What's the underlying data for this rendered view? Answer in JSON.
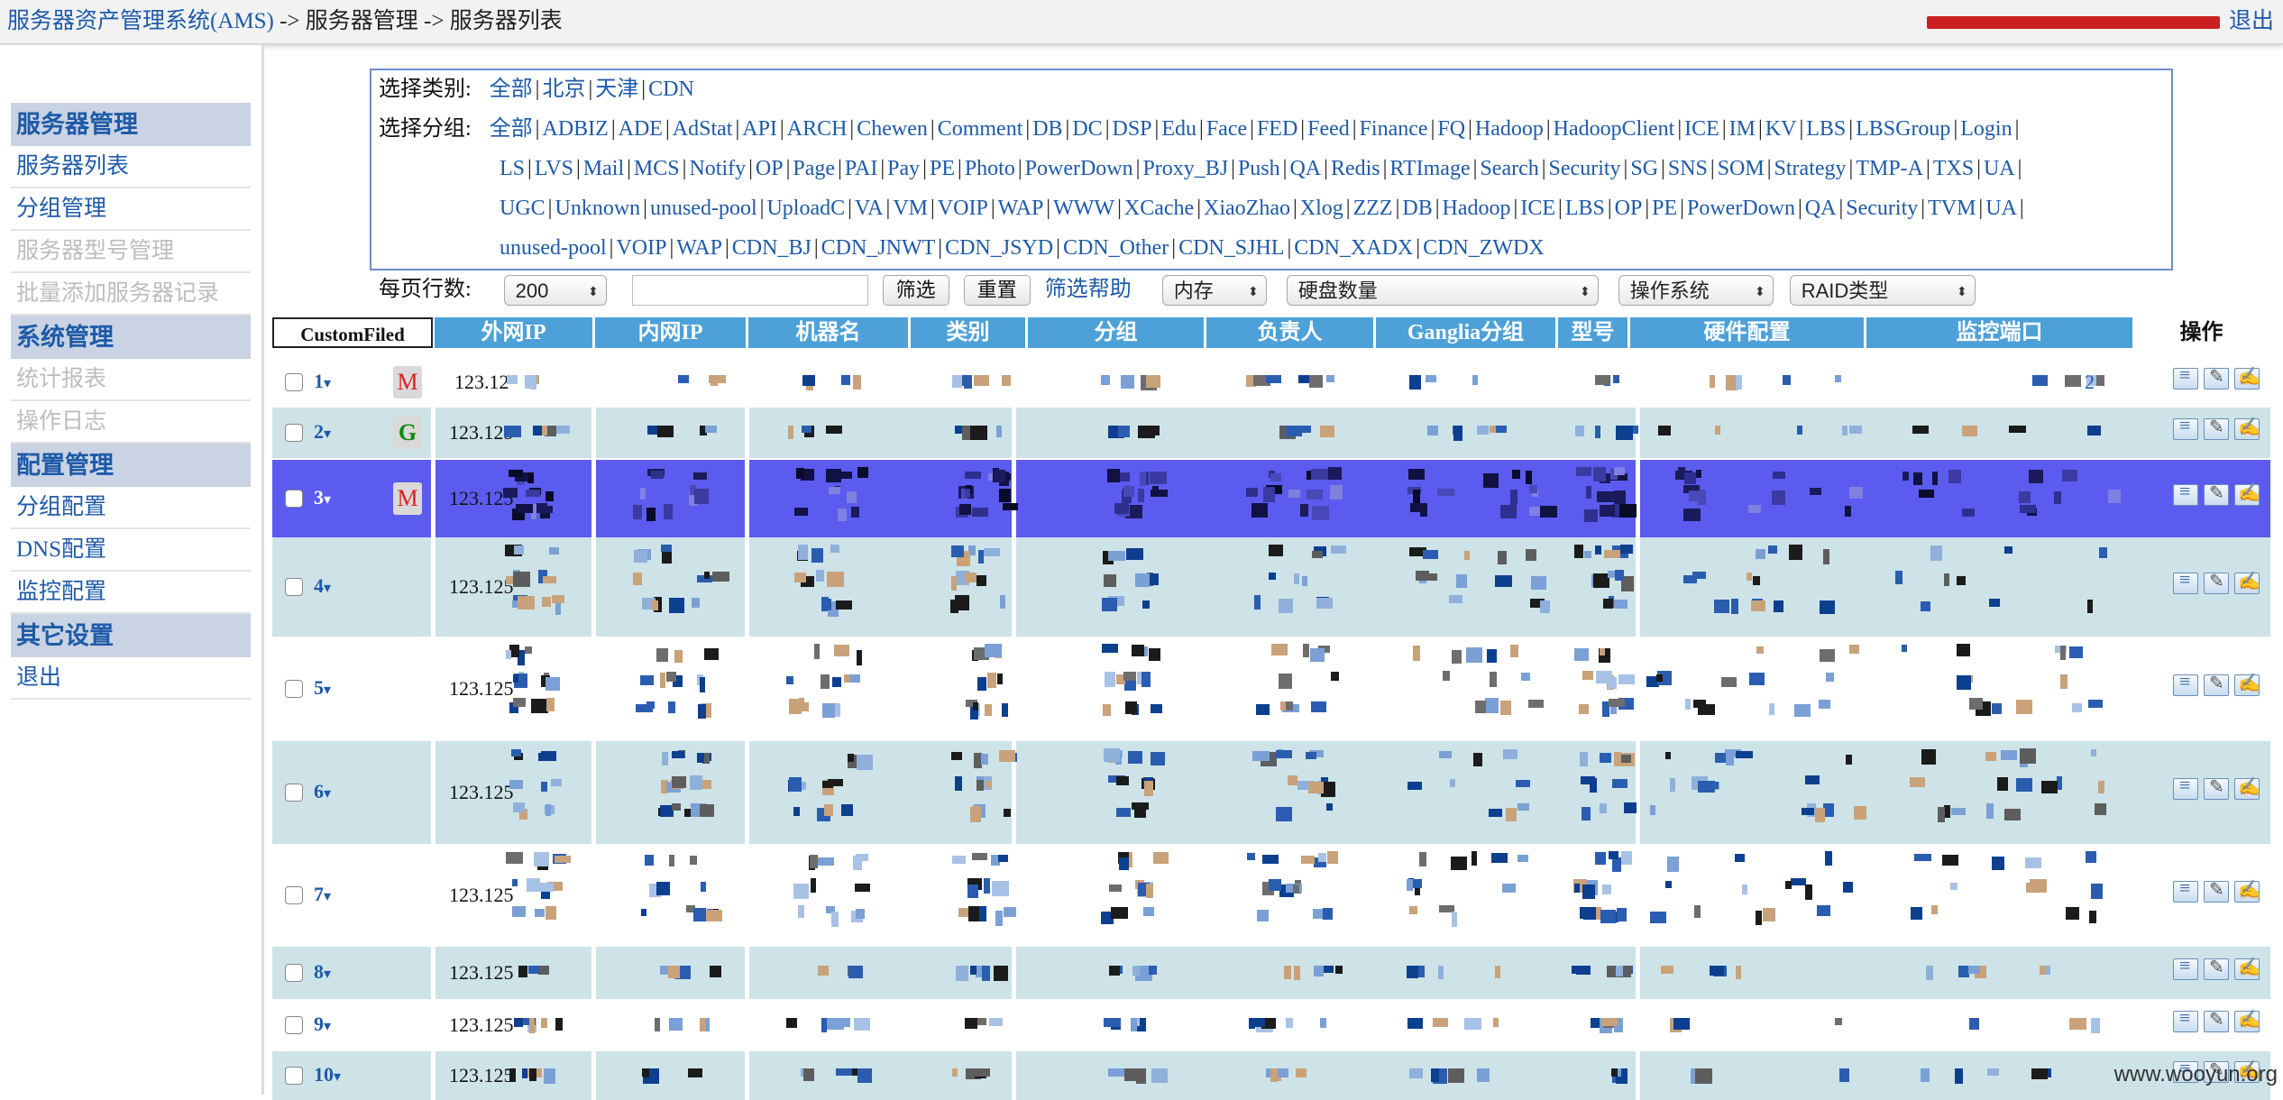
{
  "header": {
    "app_title": "服务器资产管理系统(AMS)",
    "crumb_sep": "->",
    "crumb_2": "服务器管理",
    "crumb_3": "服务器列表",
    "logout": "退出"
  },
  "sidebar": {
    "sections": [
      {
        "title": "服务器管理",
        "items": [
          {
            "label": "服务器列表",
            "state": "active"
          },
          {
            "label": "分组管理",
            "state": "active"
          },
          {
            "label": "服务器型号管理",
            "state": "disabled"
          },
          {
            "label": "批量添加服务器记录",
            "state": "disabled"
          }
        ]
      },
      {
        "title": "系统管理",
        "items": [
          {
            "label": "统计报表",
            "state": "disabled"
          },
          {
            "label": "操作日志",
            "state": "disabled"
          }
        ]
      },
      {
        "title": "配置管理",
        "items": [
          {
            "label": "分组配置",
            "state": "active"
          },
          {
            "label": "DNS配置",
            "state": "active"
          },
          {
            "label": "监控配置",
            "state": "active"
          }
        ]
      },
      {
        "title": "其它设置",
        "items": [
          {
            "label": "退出",
            "state": "active"
          }
        ]
      }
    ]
  },
  "filter": {
    "category_label": "选择类别:",
    "categories": [
      "全部",
      "北京",
      "天津",
      "CDN"
    ],
    "group_label": "选择分组:",
    "groups_line1": [
      "全部",
      "ADBIZ",
      "ADE",
      "AdStat",
      "API",
      "ARCH",
      "Chewen",
      "Comment",
      "DB",
      "DC",
      "DSP",
      "Edu",
      "Face",
      "FED",
      "Feed",
      "Finance",
      "FQ",
      "Hadoop",
      "HadoopClient",
      "ICE",
      "IM",
      "KV",
      "LBS",
      "LBSGroup",
      "Login"
    ],
    "groups_line2": [
      "LS",
      "LVS",
      "Mail",
      "MCS",
      "Notify",
      "OP",
      "Page",
      "PAI",
      "Pay",
      "PE",
      "Photo",
      "PowerDown",
      "Proxy_BJ",
      "Push",
      "QA",
      "Redis",
      "RTImage",
      "Search",
      "Security",
      "SG",
      "SNS",
      "SOM",
      "Strategy",
      "TMP-A",
      "TXS",
      "UA"
    ],
    "groups_line3": [
      "UGC",
      "Unknown",
      "unused-pool",
      "UploadC",
      "VA",
      "VM",
      "VOIP",
      "WAP",
      "WWW",
      "XCache",
      "XiaoZhao",
      "Xlog",
      "ZZZ",
      "DB",
      "Hadoop",
      "ICE",
      "LBS",
      "OP",
      "PE",
      "PowerDown",
      "QA",
      "Security",
      "TVM",
      "UA"
    ],
    "groups_line4": [
      "unused-pool",
      "VOIP",
      "WAP",
      "CDN_BJ",
      "CDN_JNWT",
      "CDN_JSYD",
      "CDN_Other",
      "CDN_SJHL",
      "CDN_XADX",
      "CDN_ZWDX"
    ],
    "rows_label": "每页行数:",
    "rows_value": "200",
    "filter_button": "筛选",
    "reset_button": "重置",
    "help_link": "筛选帮助",
    "memory_select": "内存",
    "disk_select": "硬盘数量",
    "os_select": "操作系统",
    "raid_select": "RAID类型"
  },
  "table": {
    "columns": [
      "CustomFiled",
      "外网IP",
      "内网IP",
      "机器名",
      "类别",
      "分组",
      "负责人",
      "Ganglia分组",
      "型号",
      "硬件配置",
      "监控端口",
      "操作"
    ],
    "rows": [
      {
        "num": "1",
        "badge": "M",
        "ip": "123.12"
      },
      {
        "num": "2",
        "badge": "G",
        "ip": "123.125"
      },
      {
        "num": "3",
        "badge": "M",
        "ip": "123.125"
      },
      {
        "num": "4",
        "badge": "",
        "ip": "123.125"
      },
      {
        "num": "5",
        "badge": "",
        "ip": "123.125"
      },
      {
        "num": "6",
        "badge": "",
        "ip": "123.125"
      },
      {
        "num": "7",
        "badge": "",
        "ip": "123.125"
      },
      {
        "num": "8",
        "badge": "",
        "ip": "123.125"
      },
      {
        "num": "9",
        "badge": "",
        "ip": "123.125"
      },
      {
        "num": "10",
        "badge": "",
        "ip": "123.125"
      }
    ],
    "row1_port_suffix": "2"
  },
  "watermark": "www.wooyun.org",
  "colors": {
    "link": "#1e5aa8",
    "header_blue": "#4da1d8",
    "selected_row": "#5b5bf0",
    "alt_row": "#cde3e8",
    "sidebar_section": "#c9d3e3",
    "badge_m": "#e02020",
    "badge_g": "#118811",
    "user_mask": "#cc1f1f"
  }
}
